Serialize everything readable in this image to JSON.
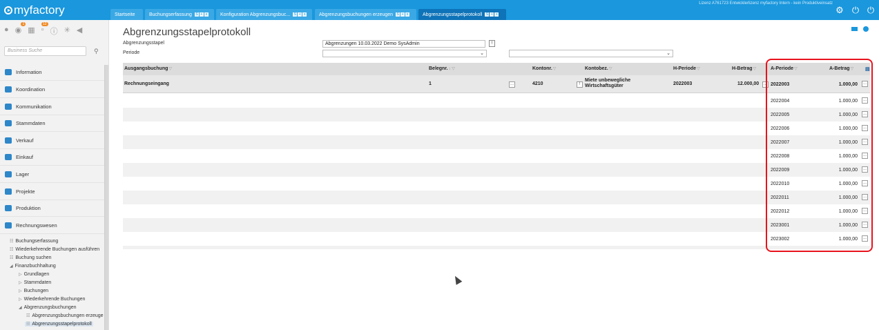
{
  "app": {
    "logo_text": "myfactory",
    "license_text": "Lizenz A761723 Entwicklerlizenz myfactory Intern - kein Produktiveinsatz"
  },
  "tabs": [
    {
      "label": "Startseite",
      "active": false
    },
    {
      "label": "Buchungserfassung",
      "active": false
    },
    {
      "label": "Konfiguration Abgrenzungsbuc...",
      "active": false
    },
    {
      "label": "Abgrenzungsbuchungen erzeugen",
      "active": false
    },
    {
      "label": "Abgrenzungsstapelprotokoll",
      "active": true
    }
  ],
  "tab_controls": [
    "S",
    "+",
    "x"
  ],
  "topbar_icons": [
    "gear-icon",
    "power-icon",
    "logout-icon"
  ],
  "sidebar": {
    "badges": {
      "tasks": "1",
      "messages": "12"
    },
    "search_placeholder": "Business Suche",
    "items": [
      {
        "label": "Information",
        "icon": "info-icon"
      },
      {
        "label": "Koordination",
        "icon": "coordination-icon"
      },
      {
        "label": "Kommunikation",
        "icon": "chat-icon"
      },
      {
        "label": "Stammdaten",
        "icon": "database-icon"
      },
      {
        "label": "Verkauf",
        "icon": "sales-icon"
      },
      {
        "label": "Einkauf",
        "icon": "cart-icon"
      },
      {
        "label": "Lager",
        "icon": "warehouse-icon"
      },
      {
        "label": "Projekte",
        "icon": "monitor-icon"
      },
      {
        "label": "Produktion",
        "icon": "production-icon"
      },
      {
        "label": "Rechnungswesen",
        "icon": "grid-icon"
      }
    ],
    "tree": [
      {
        "label": "Buchungserfassung",
        "glyph": "☷"
      },
      {
        "label": "Wiederkehrende Buchungen ausführen",
        "glyph": "☷"
      },
      {
        "label": "Buchung suchen",
        "glyph": "☷"
      },
      {
        "label": "Finanzbuchhaltung",
        "glyph": "◢"
      },
      {
        "label": "Grundlagen",
        "glyph": "▷"
      },
      {
        "label": "Stammdaten",
        "glyph": "▷"
      },
      {
        "label": "Buchungen",
        "glyph": "▷"
      },
      {
        "label": "Wiederkehrende Buchungen",
        "glyph": "▷"
      },
      {
        "label": "Abgrenzungsbuchungen",
        "glyph": "◢"
      },
      {
        "label": "Abgrenzungsbuchungen erzeuge",
        "glyph": "☷"
      },
      {
        "label": "Abgrenzungsstapelprotokoll",
        "glyph": "☷"
      }
    ]
  },
  "page": {
    "title": "Abgrenzungsstapelprotokoll",
    "stapel_label": "Abgrenzungsstapel",
    "stapel_value": "Abgrenzungen 10.03.2022 Demo SysAdmin",
    "periode_label": "Periode",
    "periode_value": "",
    "periode2_value": ""
  },
  "grid": {
    "headers": {
      "ausgangsbuchung": "Ausgangsbuchung",
      "belegnr": "Belegnr.",
      "kontonr": "Kontonr.",
      "kontobez": "Kontobez.",
      "hperiode": "H-Periode",
      "hbetrag": "H-Betrag",
      "aperiode": "A-Periode",
      "abetrag": "A-Betrag"
    },
    "main_row": {
      "ausgangsbuchung": "Rechnungseingang",
      "belegnr": "1",
      "kontonr": "4210",
      "kontobez_line1": "Miete unbewegliche",
      "kontobez_line2": "Wirtschaftsgüter",
      "hperiode": "2022003",
      "hbetrag": "12.000,00"
    },
    "accrual_rows": [
      {
        "periode": "2022003",
        "betrag": "1.000,00"
      },
      {
        "periode": "2022004",
        "betrag": "1.000,00"
      },
      {
        "periode": "2022005",
        "betrag": "1.000,00"
      },
      {
        "periode": "2022006",
        "betrag": "1.000,00"
      },
      {
        "periode": "2022007",
        "betrag": "1.000,00"
      },
      {
        "periode": "2022008",
        "betrag": "1.000,00"
      },
      {
        "periode": "2022009",
        "betrag": "1.000,00"
      },
      {
        "periode": "2022010",
        "betrag": "1.000,00"
      },
      {
        "periode": "2022011",
        "betrag": "1.000,00"
      },
      {
        "periode": "2022012",
        "betrag": "1.000,00"
      },
      {
        "periode": "2023001",
        "betrag": "1.000,00"
      },
      {
        "periode": "2023002",
        "betrag": "1.000,00"
      }
    ],
    "row_button_label": "...",
    "info_button_label": "!",
    "highlight_color": "#e8121c"
  }
}
